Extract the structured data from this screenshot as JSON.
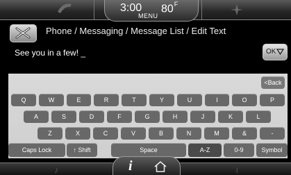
{
  "status": {
    "time": "3:00",
    "menu": "MENU",
    "temperature": "80",
    "temp_unit": "F"
  },
  "header": {
    "breadcrumb": "Phone / Messaging / Message List / Edit Text"
  },
  "message": {
    "text": "See you in a few! _"
  },
  "buttons": {
    "ok": "OK",
    "back": "<Back"
  },
  "keyboard": {
    "row1": [
      "Q",
      "W",
      "E",
      "R",
      "T",
      "Y",
      "U",
      "I",
      "O",
      "P"
    ],
    "row2": [
      "A",
      "S",
      "D",
      "F",
      "G",
      "H",
      "J",
      "K",
      "L"
    ],
    "row3": [
      "Z",
      "X",
      "C",
      "V",
      "B",
      "N",
      "M",
      "&",
      "-"
    ],
    "bottom": {
      "caps_lock": "Caps Lock",
      "shift": "Shift",
      "space": "Space",
      "az": "A-Z",
      "digits": "0-9",
      "symbol": "Symbol"
    }
  },
  "icons": {
    "close": "close-icon",
    "ok_arrow": "triangle-down-icon",
    "phone": "phone-icon",
    "nav": "navigation-icon",
    "info": "info-icon",
    "home": "home-icon",
    "music": "music-icon",
    "climate": "climate-icon"
  }
}
